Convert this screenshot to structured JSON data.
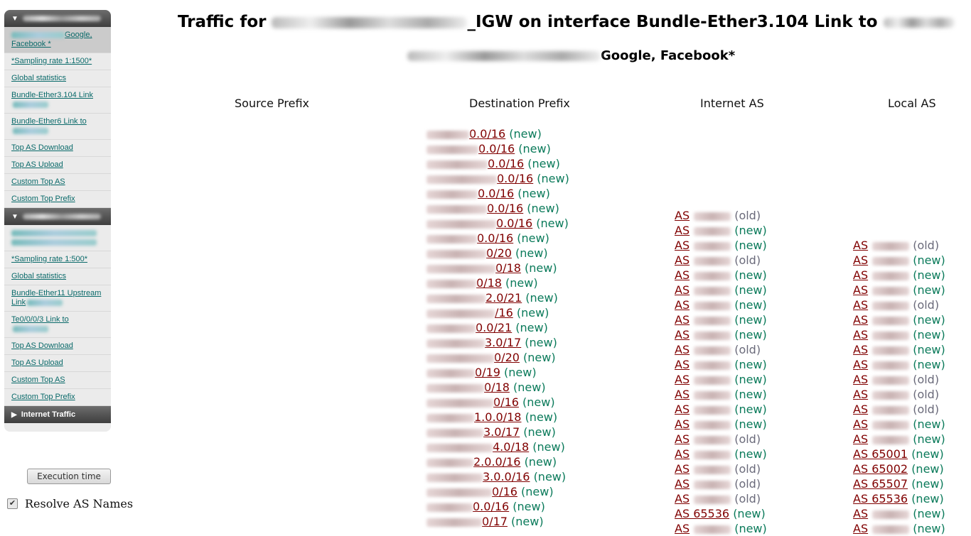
{
  "sidebar": {
    "groups": [
      {
        "header": "[redacted]",
        "items": [
          {
            "label": "Google, Facebook *",
            "prefix_redacted": true,
            "active": true
          },
          {
            "label": "*Sampling rate 1:1500*"
          },
          {
            "label": "Global statistics"
          },
          {
            "label": "Bundle-Ether3.104 Link",
            "suffix_redacted": true
          },
          {
            "label": "Bundle-Ether6 Link to",
            "suffix_redacted": true
          },
          {
            "label": "Top AS Download"
          },
          {
            "label": "Top AS Upload"
          },
          {
            "label": "Custom Top AS"
          },
          {
            "label": "Custom Top Prefix"
          }
        ]
      },
      {
        "header": "[redacted]",
        "items": [
          {
            "label": "[redacted]",
            "redacted": true
          },
          {
            "label": "*Sampling rate 1:500*"
          },
          {
            "label": "Global statistics"
          },
          {
            "label": "Bundle-Ether11 Upstream Link",
            "suffix_redacted": true
          },
          {
            "label": "Te0/0/0/3 Link to",
            "suffix_redacted": true
          },
          {
            "label": "Top AS Download"
          },
          {
            "label": "Top AS Upload"
          },
          {
            "label": "Custom Top AS"
          },
          {
            "label": "Custom Top Prefix"
          }
        ]
      }
    ],
    "collapsed_group": "Internet Traffic",
    "exec_button": "Execution time",
    "resolve_label": "Resolve AS Names",
    "resolve_checked": true
  },
  "header": {
    "title_prefix": "Traffic for",
    "title_middle": "_IGW on interface Bundle-Ether3.104 Link to",
    "subtitle_suffix": "Google, Facebook*"
  },
  "columns": [
    "Source Prefix",
    "Destination Prefix",
    "Internet AS",
    "Local AS"
  ],
  "destination_prefixes": [
    {
      "visible": "0.0/16",
      "status": "(new)"
    },
    {
      "visible": "0.0/16",
      "status": "(new)"
    },
    {
      "visible": "0.0/16",
      "status": "(new)"
    },
    {
      "visible": "0.0/16",
      "status": "(new)"
    },
    {
      "visible": "0.0/16",
      "status": "(new)"
    },
    {
      "visible": "0.0/16",
      "status": "(new)"
    },
    {
      "visible": "0.0/16",
      "status": "(new)"
    },
    {
      "visible": "0.0/16",
      "status": "(new)"
    },
    {
      "visible": "0/20",
      "status": "(new)"
    },
    {
      "visible": "0/18",
      "status": "(new)"
    },
    {
      "visible": "0/18",
      "status": "(new)"
    },
    {
      "visible": "2.0/21",
      "status": "(new)"
    },
    {
      "visible": "/16",
      "status": "(new)"
    },
    {
      "visible": "0.0/21",
      "status": "(new)"
    },
    {
      "visible": "3.0/17",
      "status": "(new)"
    },
    {
      "visible": "0/20",
      "status": "(new)"
    },
    {
      "visible": "0/19",
      "status": "(new)"
    },
    {
      "visible": "0/18",
      "status": "(new)"
    },
    {
      "visible": "0/16",
      "status": "(new)"
    },
    {
      "visible": "1.0.0/18",
      "status": "(new)"
    },
    {
      "visible": "3.0/17",
      "status": "(new)"
    },
    {
      "visible": "4.0/18",
      "status": "(new)"
    },
    {
      "visible": "2.0.0/16",
      "status": "(new)"
    },
    {
      "visible": "3.0.0/16",
      "status": "(new)"
    },
    {
      "visible": "0/16",
      "status": "(new)"
    },
    {
      "visible": "0.0/16",
      "status": "(new)"
    },
    {
      "visible": "0/17",
      "status": "(new)"
    }
  ],
  "internet_as": [
    {
      "as": "AS",
      "status": "(old)"
    },
    {
      "as": "AS",
      "status": "(new)"
    },
    {
      "as": "AS",
      "status": "(new)"
    },
    {
      "as": "AS",
      "status": "(old)"
    },
    {
      "as": "AS",
      "status": "(new)"
    },
    {
      "as": "AS",
      "status": "(new)"
    },
    {
      "as": "AS",
      "status": "(new)"
    },
    {
      "as": "AS",
      "status": "(new)"
    },
    {
      "as": "AS",
      "status": "(new)"
    },
    {
      "as": "AS",
      "status": "(old)"
    },
    {
      "as": "AS",
      "status": "(new)"
    },
    {
      "as": "AS",
      "status": "(new)"
    },
    {
      "as": "AS",
      "status": "(new)"
    },
    {
      "as": "AS",
      "status": "(new)"
    },
    {
      "as": "AS",
      "status": "(new)"
    },
    {
      "as": "AS",
      "status": "(old)"
    },
    {
      "as": "AS",
      "status": "(new)"
    },
    {
      "as": "AS",
      "status": "(old)"
    },
    {
      "as": "AS",
      "status": "(old)"
    },
    {
      "as": "AS",
      "status": "(old)"
    },
    {
      "as": "AS 65536",
      "status": "(new)",
      "unredacted": true
    },
    {
      "as": "AS",
      "status": "(new)"
    }
  ],
  "local_as": [
    {
      "as": "AS",
      "status": "(old)"
    },
    {
      "as": "AS",
      "status": "(new)"
    },
    {
      "as": "AS",
      "status": "(new)"
    },
    {
      "as": "AS",
      "status": "(new)"
    },
    {
      "as": "AS",
      "status": "(old)"
    },
    {
      "as": "AS",
      "status": "(new)"
    },
    {
      "as": "AS",
      "status": "(new)"
    },
    {
      "as": "AS",
      "status": "(new)"
    },
    {
      "as": "AS",
      "status": "(new)"
    },
    {
      "as": "AS",
      "status": "(old)"
    },
    {
      "as": "AS",
      "status": "(old)"
    },
    {
      "as": "AS",
      "status": "(old)"
    },
    {
      "as": "AS",
      "status": "(new)"
    },
    {
      "as": "AS",
      "status": "(new)"
    },
    {
      "as": "AS 65001",
      "status": "(new)",
      "unredacted": true
    },
    {
      "as": "AS 65002",
      "status": "(new)",
      "unredacted": true
    },
    {
      "as": "AS 65507",
      "status": "(new)",
      "unredacted": true
    },
    {
      "as": "AS 65536",
      "status": "(new)",
      "unredacted": true
    },
    {
      "as": "AS",
      "status": "(new)"
    },
    {
      "as": "AS",
      "status": "(new)"
    }
  ],
  "colors": {
    "link": "#800000",
    "status_new": "#0a7a5a",
    "status_old": "#6a6a7a",
    "sidebar_link": "#0a6a6a"
  }
}
